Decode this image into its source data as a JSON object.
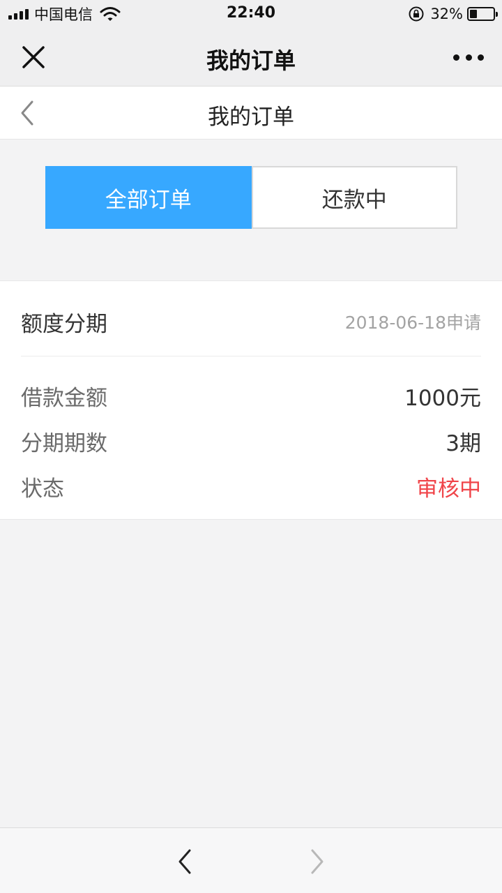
{
  "status_bar": {
    "carrier": "中国电信",
    "time": "22:40",
    "battery_percent": "32%",
    "battery_level": 0.32,
    "icons": [
      "signal-icon",
      "wifi-icon",
      "rotation-lock-icon",
      "battery-icon"
    ]
  },
  "wechat_header": {
    "title": "我的订单",
    "icons": [
      "close-icon",
      "more-icon"
    ]
  },
  "page_nav": {
    "title": "我的订单",
    "icons": [
      "chevron-left-icon"
    ]
  },
  "tabs": [
    {
      "label": "全部订单",
      "active": true
    },
    {
      "label": "还款中",
      "active": false
    }
  ],
  "order": {
    "type": "额度分期",
    "date": "2018-06-18申请",
    "rows": [
      {
        "label": "借款金额",
        "value": "1000元"
      },
      {
        "label": "分期期数",
        "value": "3期"
      },
      {
        "label": "状态",
        "value": "审核中"
      }
    ]
  },
  "bottom_bar": {
    "icons": [
      "browser-back-icon",
      "browser-forward-icon"
    ]
  },
  "colors": {
    "accent": "#37a8ff",
    "status_red": "#f0454a",
    "background": "#f3f3f4"
  }
}
